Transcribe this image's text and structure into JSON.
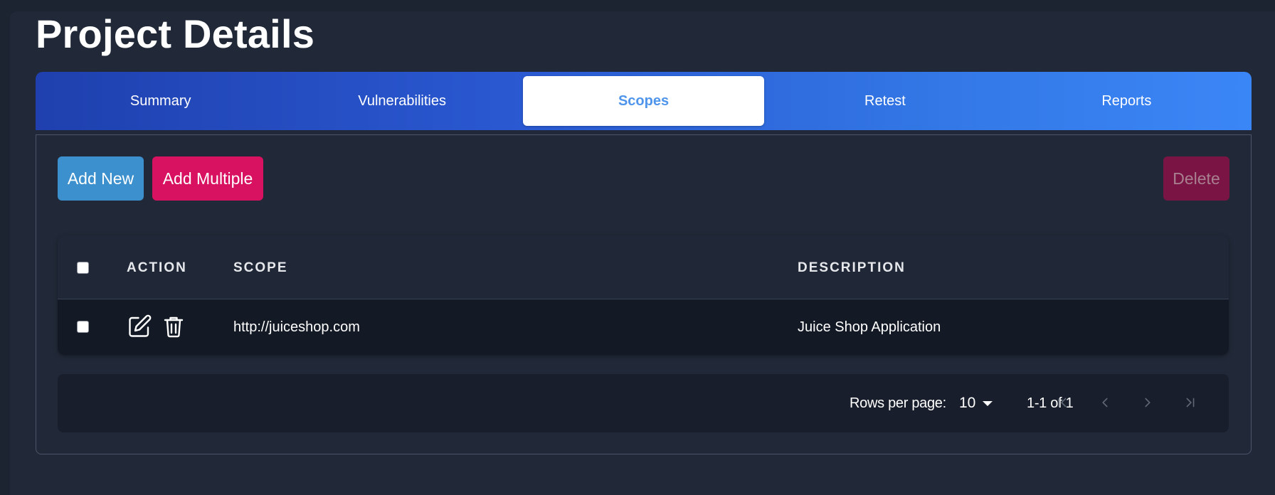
{
  "page": {
    "title": "Project Details"
  },
  "tabs": [
    {
      "label": "Summary",
      "active": false
    },
    {
      "label": "Vulnerabilities",
      "active": false
    },
    {
      "label": "Scopes",
      "active": true
    },
    {
      "label": "Retest",
      "active": false
    },
    {
      "label": "Reports",
      "active": false
    }
  ],
  "toolbar": {
    "add_new_label": "Add New",
    "add_multiple_label": "Add Multiple",
    "delete_label": "Delete"
  },
  "table": {
    "columns": [
      "ACTION",
      "SCOPE",
      "DESCRIPTION"
    ],
    "rows": [
      {
        "scope": "http://juiceshop.com",
        "description": "Juice Shop Application",
        "selected": false
      }
    ],
    "select_all_checked": false
  },
  "pagination": {
    "rows_per_page_label": "Rows per page:",
    "rows_per_page_value": "10",
    "range_text": "1-1 of 1"
  },
  "icons": {
    "row_actions": [
      "edit-icon",
      "trash-icon"
    ],
    "pager": [
      "first-page-icon",
      "prev-page-icon",
      "next-page-icon",
      "last-page-icon"
    ]
  },
  "colors": {
    "background": "#212938",
    "tab_gradient_start": "#1f40ae",
    "tab_gradient_end": "#3b86f7",
    "active_tab_text": "#4f95ec",
    "add_new": "#3c90cd",
    "add_multiple": "#d81161",
    "delete_disabled": "#7a1445"
  }
}
